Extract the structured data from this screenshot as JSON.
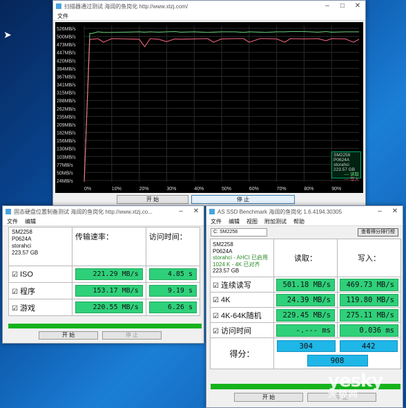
{
  "graph_window": {
    "title": "扫描器通过测试  海阔的鱼岗化   http://www.xtzj.com/",
    "menu": [
      "文件"
    ],
    "buttons": [
      "开 始",
      "停 止"
    ],
    "y_labels": [
      "526MB/s",
      "500MB/s",
      "473MB/s",
      "447MB/s",
      "420MB/s",
      "394MB/s",
      "367MB/s",
      "341MB/s",
      "315MB/s",
      "288MB/s",
      "262MB/s",
      "235MB/s",
      "209MB/s",
      "182MB/s",
      "156MB/s",
      "130MB/s",
      "103MB/s",
      "77MB/s",
      "50MB/s",
      "24MB/s"
    ],
    "x_labels": [
      "0%",
      "10%",
      "20%",
      "30%",
      "40%",
      "50%",
      "60%",
      "70%",
      "80%",
      "90%"
    ],
    "legend": {
      "drive": "SM2258",
      "firmware": "P0624A",
      "driver": "storahci",
      "size": "223.57 GB",
      "series": [
        "读取",
        "写入"
      ]
    },
    "colors": {
      "read": "#6fdc7f",
      "write": "#ff6a86",
      "grid": "#2a2a2a",
      "text": "#d8d8d8"
    }
  },
  "chart_data": {
    "type": "line",
    "x": [
      0,
      2,
      3,
      5,
      7,
      10,
      15,
      20,
      22,
      24,
      27,
      30,
      33,
      35,
      40,
      45,
      47,
      50,
      55,
      58,
      60,
      64,
      66,
      70,
      73,
      75,
      80,
      85,
      88,
      90,
      95,
      98,
      100
    ],
    "series": [
      {
        "name": "读取",
        "values": [
          0,
          500,
          500,
          505,
          503,
          503,
          504,
          505,
          504,
          505,
          504,
          505,
          506,
          504,
          505,
          503,
          504,
          505,
          505,
          503,
          505,
          504,
          503,
          505,
          505,
          506,
          506,
          504,
          506,
          504,
          505,
          505,
          505
        ]
      },
      {
        "name": "写入",
        "values": [
          0,
          480,
          480,
          482,
          470,
          482,
          481,
          480,
          455,
          482,
          480,
          472,
          481,
          480,
          481,
          482,
          470,
          481,
          482,
          482,
          470,
          482,
          482,
          481,
          470,
          482,
          481,
          482,
          475,
          482,
          481,
          470,
          480
        ]
      }
    ],
    "ylim": [
      0,
      526
    ],
    "grid": true
  },
  "hdtune_window": {
    "title": "固态硬盘位置制备测试  海阔的鱼岗化  http://www.xtzj.co...",
    "menu": [
      "文件",
      "编辑"
    ],
    "drive_info": [
      "SM2258",
      "P0624A",
      "storahci",
      "223.57 GB"
    ],
    "col_speed": "传输速率：",
    "col_access": "访问时间：",
    "rows": [
      {
        "label": "ISO",
        "speed": "221.29 MB/s",
        "access": "4.85 s"
      },
      {
        "label": "程序",
        "speed": "153.17 MB/s",
        "access": "9.19 s"
      },
      {
        "label": "游戏",
        "speed": "220.55 MB/s",
        "access": "6.26 s"
      }
    ],
    "buttons": [
      "开 始",
      "停 止"
    ]
  },
  "asssd_window": {
    "title": "AS SSD Benchmark  海阔的鱼岗化 1.6.4194.30305",
    "menu": [
      "文件",
      "编辑",
      "视图",
      "附加测试",
      "帮助"
    ],
    "drive_select": "C: SM2258",
    "rank_button": "查看得分排行榜",
    "drive_info": [
      "SM2258",
      "P0624A",
      "storahci - AHCI 已启用",
      "1024 K - 4K 已对齐",
      "223.57 GB"
    ],
    "col_read": "读取：",
    "col_write": "写入：",
    "rows": [
      {
        "label": "连续读写",
        "read": "501.18 MB/s",
        "write": "469.73 MB/s"
      },
      {
        "label": "4K",
        "read": "24.39 MB/s",
        "write": "119.80 MB/s"
      },
      {
        "label": "4K-64K随机",
        "read": "229.45 MB/s",
        "write": "275.11 MB/s"
      },
      {
        "label": "访问时间",
        "read": "-.--- ms",
        "write": "0.036 ms"
      }
    ],
    "score_label": "得分：",
    "score_read": "304",
    "score_write": "442",
    "score_total": "908",
    "buttons": [
      "开 始",
      "中 止"
    ]
  },
  "watermark": {
    "brand": "yesky",
    "sub": "天极网"
  }
}
